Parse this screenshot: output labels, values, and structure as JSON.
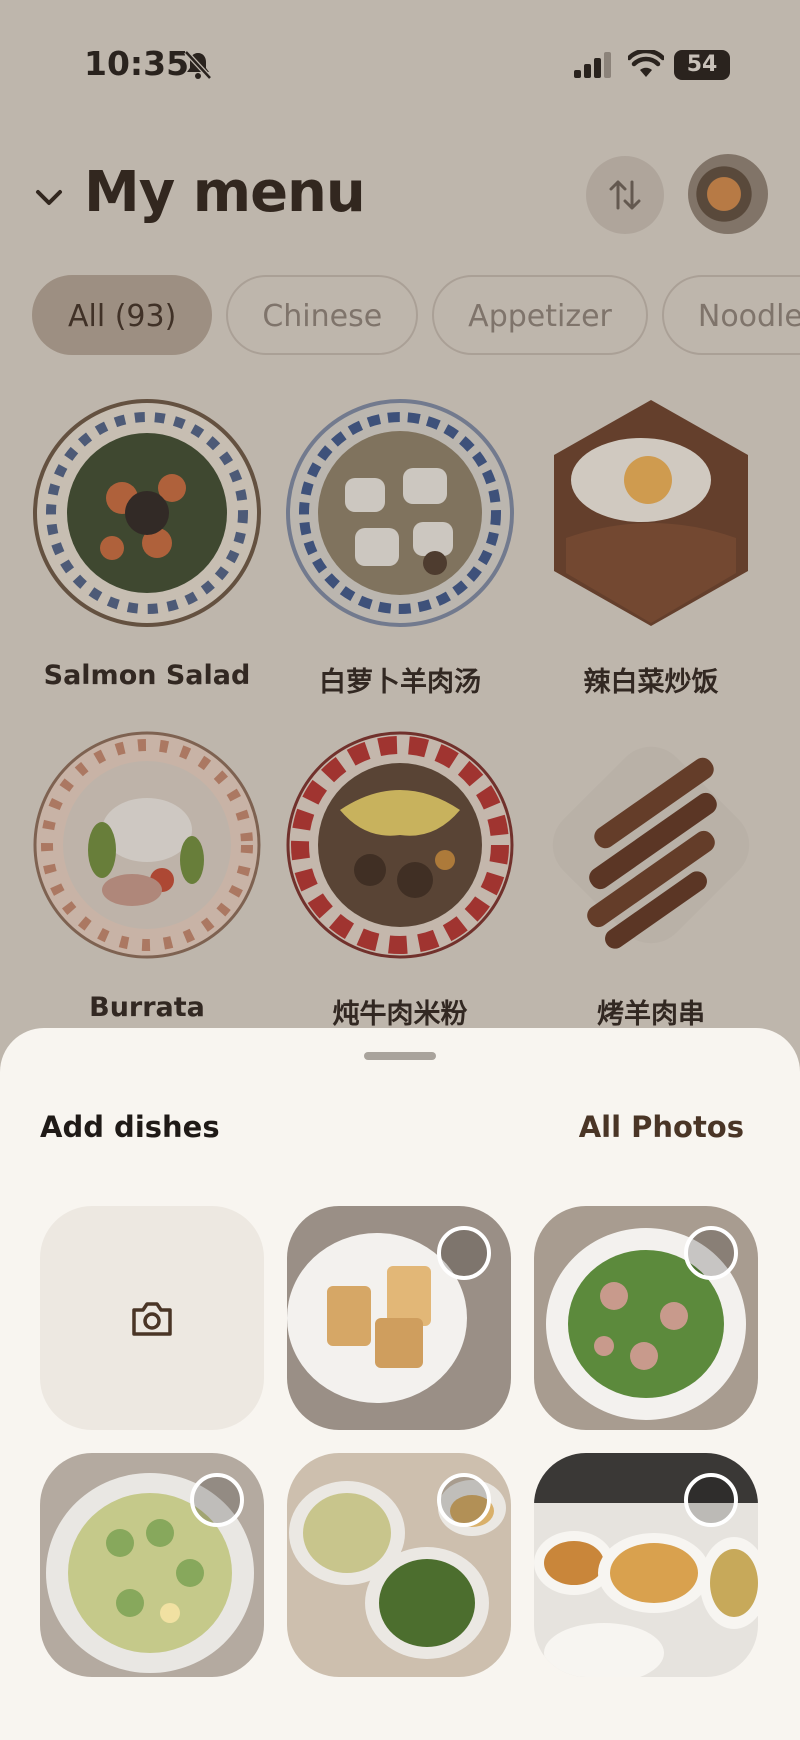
{
  "status_bar": {
    "time": "10:35",
    "battery": "54"
  },
  "header": {
    "title": "My menu"
  },
  "filters": [
    "All (93)",
    "Chinese",
    "Appetizer",
    "Noodle"
  ],
  "dishes": [
    {
      "name": "Salmon Salad"
    },
    {
      "name": "白萝卜羊肉汤"
    },
    {
      "name": "辣白菜炒饭"
    },
    {
      "name": "Burrata"
    },
    {
      "name": "炖牛肉米粉"
    },
    {
      "name": "烤羊肉串"
    }
  ],
  "sheet": {
    "title": "Add dishes",
    "all_photos": "All Photos"
  },
  "icons": [
    "bell-slash-icon",
    "signal-icon",
    "wifi-icon",
    "chevron-down-icon",
    "sort-icon",
    "camera-icon"
  ]
}
